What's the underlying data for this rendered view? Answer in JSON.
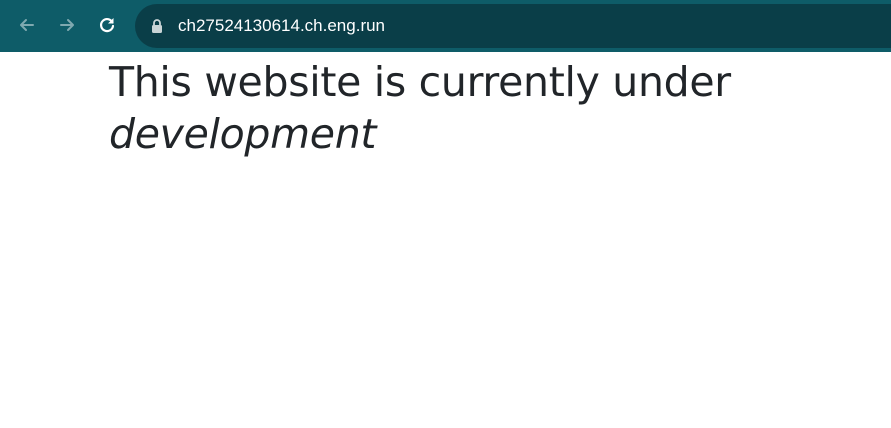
{
  "browser": {
    "url": "ch27524130614.ch.eng.run",
    "icons": {
      "back": "arrow-left-icon",
      "forward": "arrow-right-icon",
      "reload": "reload-icon",
      "lock": "lock-icon"
    },
    "colors": {
      "toolbar": "#0e5c68",
      "omnibox": "#0a3e48"
    }
  },
  "page": {
    "heading_plain": "This website is currently under",
    "heading_emphasis": "development"
  }
}
